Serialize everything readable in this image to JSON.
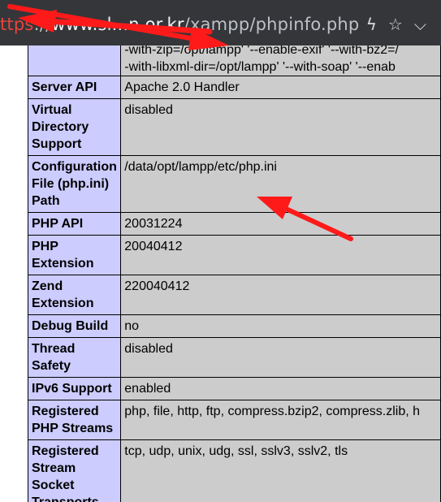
{
  "browser": {
    "url_scheme": "ttps",
    "url_sep": "://",
    "url_host": "www.sl...n.or.kr",
    "url_path": "/xampp/phpinfo.php?",
    "icons": [
      "lightning-icon",
      "star-icon",
      "chevron-down-icon"
    ],
    "icon_glyphs": {
      "lightning": "ϟ",
      "star": "☆",
      "chevron": "⌵"
    }
  },
  "table": {
    "config_lines": [
      "-with-zip=/opt/lampp' '--enable-exif' '--with-bz2=/",
      "-with-libxml-dir=/opt/lampp' '--with-soap' '--enab"
    ],
    "rows": [
      {
        "key": "Server API",
        "value": "Apache 2.0 Handler"
      },
      {
        "key": "Virtual Directory Support",
        "value": "disabled"
      },
      {
        "key": "Configuration File (php.ini) Path",
        "value": "/data/opt/lampp/etc/php.ini"
      },
      {
        "key": "PHP API",
        "value": "20031224"
      },
      {
        "key": "PHP Extension",
        "value": "20040412"
      },
      {
        "key": "Zend Extension",
        "value": "220040412"
      },
      {
        "key": "Debug Build",
        "value": "no"
      },
      {
        "key": "Thread Safety",
        "value": "disabled"
      },
      {
        "key": "IPv6 Support",
        "value": "enabled"
      },
      {
        "key": "Registered PHP Streams",
        "value": "php, file, http, ftp, compress.bzip2, compress.zlib, h"
      },
      {
        "key": "Registered Stream Socket Transports",
        "value": "tcp, udp, unix, udg, ssl, sslv3, sslv2, tls"
      }
    ]
  },
  "colors": {
    "key_bg": "#ccccff",
    "value_bg": "#cccccc",
    "addrbar_bg": "#35363a",
    "annotation": "#ff1a1a"
  }
}
